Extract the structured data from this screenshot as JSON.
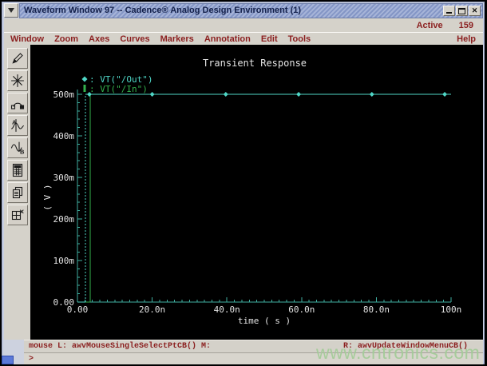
{
  "window": {
    "title": "Waveform Window 97 -- Cadence® Analog Design Environment (1)",
    "active_label": "Active",
    "active_count": "159",
    "controls": {
      "minimize": "minimize-icon",
      "maximize": "maximize-icon",
      "close_glyph": "✕"
    }
  },
  "menu": {
    "items": [
      "Window",
      "Zoom",
      "Axes",
      "Curves",
      "Markers",
      "Annotation",
      "Edit",
      "Tools"
    ],
    "help": "Help"
  },
  "toolbar": {
    "buttons": [
      {
        "name": "draw-tool",
        "icon": "pen-icon"
      },
      {
        "name": "zoom-unzoom",
        "icon": "starburst-icon"
      },
      {
        "name": "curve-tool",
        "icon": "arc-icon"
      },
      {
        "name": "vertical-marker",
        "icon": "waveform-a-icon"
      },
      {
        "name": "horizontal-marker",
        "icon": "waveform-b-icon"
      },
      {
        "name": "calculator",
        "icon": "calculator-icon"
      },
      {
        "name": "copy-window",
        "icon": "copy-icon"
      },
      {
        "name": "subwindow",
        "icon": "split-window-icon"
      }
    ]
  },
  "chart_data": {
    "type": "line",
    "title": "Transient Response",
    "xlabel": "time ( s )",
    "ylabel": "( V )",
    "xlim": [
      0,
      100
    ],
    "ylim": [
      0,
      0.5
    ],
    "x_ticks": {
      "values": [
        0,
        20,
        40,
        60,
        80,
        100
      ],
      "labels": [
        "0.00",
        "20.0n",
        "40.0n",
        "60.0n",
        "80.0n",
        "100n"
      ],
      "minor_step": 2
    },
    "y_ticks": {
      "values": [
        0,
        0.1,
        0.2,
        0.3,
        0.4,
        0.5
      ],
      "labels": [
        "0.00",
        "100m",
        "200m",
        "300m",
        "400m",
        "500m"
      ],
      "minor_step": 0.02
    },
    "axis_color": "#3fae9f",
    "text_color": "#e4e4e4",
    "background": "#000000",
    "legend_position": "top-left",
    "grid": false,
    "x_unit": "ns",
    "series": [
      {
        "key": "out",
        "name": "VT(\"/Out\")",
        "color": "#4fd6c6",
        "legend_marker": "diamond",
        "dashed_rise": true,
        "x": [
          0,
          2.1,
          2.1,
          100
        ],
        "y": [
          0,
          0,
          0.5,
          0.5
        ],
        "marker_x": [
          3.2,
          20,
          39.7,
          59.2,
          78.8,
          98.3
        ],
        "marker_y": 0.5
      },
      {
        "key": "in",
        "name": "VT(\"/In\")",
        "color": "#33b04d",
        "legend_marker": "bar",
        "dashed_rise": false,
        "x": [
          0,
          3.4,
          3.4,
          100
        ],
        "y": [
          0,
          0,
          0.5,
          0.5
        ]
      }
    ]
  },
  "status": {
    "mouse_left": "mouse L: awvMouseSingleSelectPtCB()",
    "middle": "M:",
    "right": "R: awvUpdateWindowMenuCB()",
    "prompt": ">"
  },
  "watermark": "www.cntronics.com"
}
